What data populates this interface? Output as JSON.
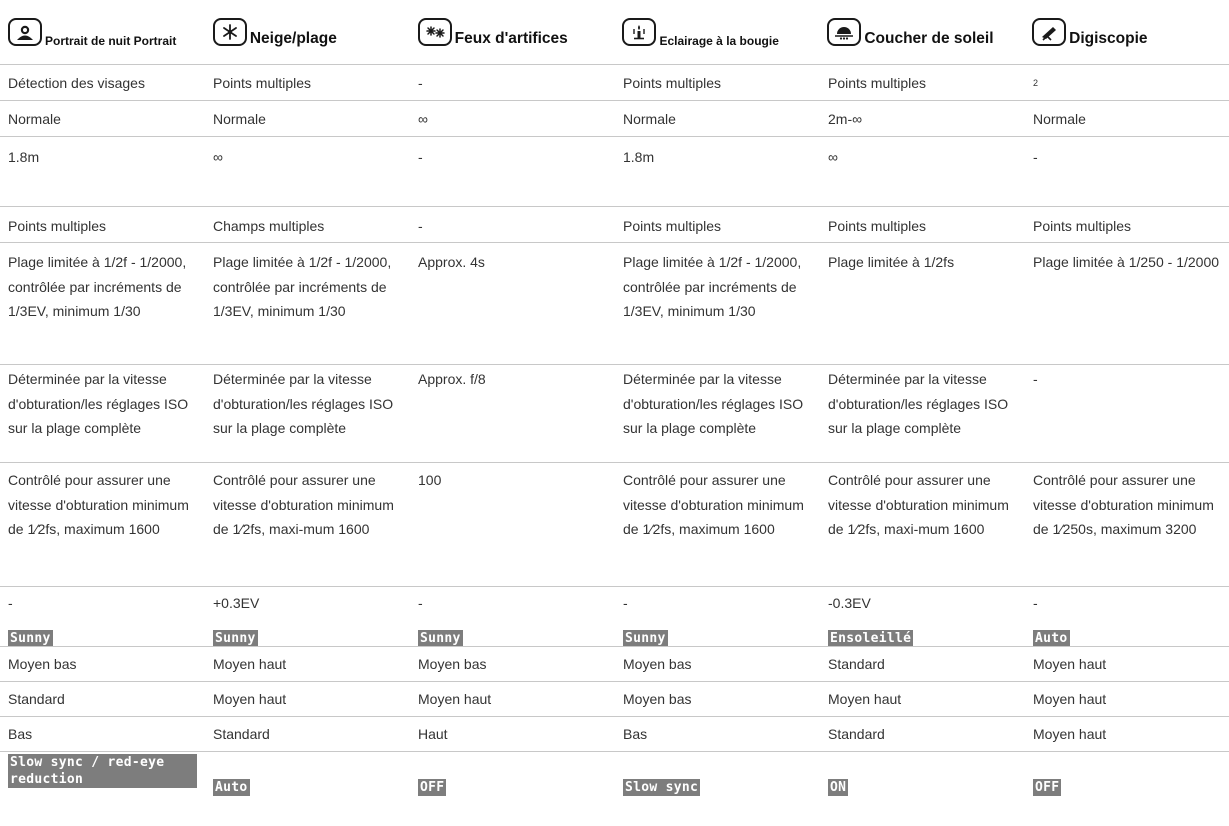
{
  "headers": [
    {
      "icon": "portrait-icon",
      "title": "Portrait de nuit Portrait",
      "small": true
    },
    {
      "icon": "snowflake-icon",
      "title": "Neige/plage",
      "small": false
    },
    {
      "icon": "fireworks-icon",
      "title": "Feux d'artifices",
      "small": false
    },
    {
      "icon": "candle-icon",
      "title": "Eclairage à la bougie",
      "small": true
    },
    {
      "icon": "sunset-icon",
      "title": "Coucher de soleil",
      "small": false
    },
    {
      "icon": "digiscope-icon",
      "title": "Digiscopie",
      "small": false
    }
  ],
  "rows": [
    [
      "Détection des visages",
      "Points multiples",
      "-",
      "Points multiples",
      "Points multiples",
      ""
    ],
    [
      "Normale",
      "Normale",
      "∞",
      "Normale",
      "2m-∞",
      "Normale"
    ],
    [
      "1.8m",
      "∞",
      "-",
      "1.8m",
      "∞",
      "-"
    ],
    [
      "Points multiples",
      "Champs multiples",
      "-",
      "Points multiples",
      "Points multiples",
      "Points multiples"
    ],
    [
      "Plage limitée à 1/2f - 1/2000, contrôlée par incréments de 1/3EV, minimum 1/30",
      "Plage limitée à 1/2f - 1/2000, contrôlée par incréments de 1/3EV, minimum 1/30",
      "Approx. 4s",
      "Plage limitée à 1/2f - 1/2000, contrôlée par incréments de 1/3EV, minimum 1/30",
      "Plage limitée à 1/2fs",
      "Plage limitée à 1/250 - 1/2000"
    ],
    [
      "Déterminée par la vitesse d'obturation/les réglages ISO sur la plage complète",
      "Déterminée par la vitesse d'obturation/les réglages ISO sur la plage complète",
      "Approx. f/8",
      "Déterminée par la vitesse d'obturation/les réglages ISO sur la plage complète",
      "Déterminée par la vitesse d'obturation/les réglages ISO sur la plage complète",
      "-"
    ],
    [
      "Contrôlé pour assurer une vitesse d'obturation minimum de 1⁄2fs, maximum 1600",
      "Contrôlé pour assurer une vitesse d'obturation minimum de 1⁄2fs, maxi-mum 1600",
      "100",
      "Contrôlé pour assurer une vitesse d'obturation minimum de 1⁄2fs, maximum 1600",
      "Contrôlé pour assurer une vitesse d'obturation minimum de 1⁄2fs, maxi-mum 1600",
      "Contrôlé pour assurer une vitesse d'obturation minimum de 1⁄250s, maximum 3200"
    ],
    [
      "-",
      "+0.3EV",
      "-",
      "-",
      "-0.3EV",
      "-"
    ],
    [
      "Sunny",
      "Sunny",
      "Sunny",
      "Sunny",
      "Ensoleillé",
      "Auto"
    ],
    [
      "Moyen bas",
      "Moyen haut",
      "Moyen bas",
      "Moyen bas",
      "Standard",
      "Moyen haut"
    ],
    [
      "Standard",
      "Moyen haut",
      "Moyen haut",
      "Moyen bas",
      "Moyen haut",
      "Moyen haut"
    ],
    [
      "Bas",
      "Standard",
      "Haut",
      "Bas",
      "Standard",
      "Moyen haut"
    ],
    [
      "Slow sync / red-eye reduction",
      "Auto",
      "OFF",
      "Slow sync",
      "ON",
      "OFF"
    ]
  ],
  "footnote_marker": "2",
  "lcd_color": "#7d7d7d"
}
